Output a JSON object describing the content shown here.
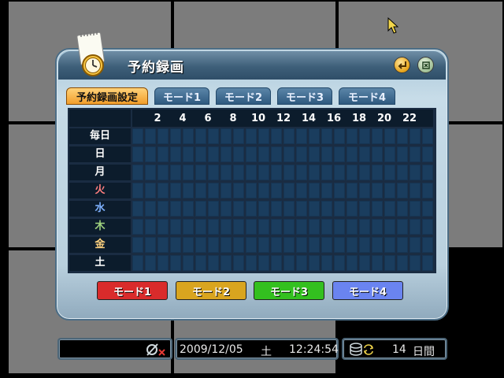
{
  "dialog": {
    "title": "予約録画",
    "enter_icon": "enter-icon",
    "close_icon": "close-icon"
  },
  "tabs": [
    {
      "label": "予約録画設定",
      "active": true
    },
    {
      "label": "モード1",
      "active": false
    },
    {
      "label": "モード2",
      "active": false
    },
    {
      "label": "モード3",
      "active": false
    },
    {
      "label": "モード4",
      "active": false
    }
  ],
  "schedule": {
    "hour_labels": [
      "2",
      "4",
      "6",
      "8",
      "10",
      "12",
      "14",
      "16",
      "18",
      "20",
      "22"
    ],
    "days": [
      {
        "label": "毎日",
        "color": "#ffffff"
      },
      {
        "label": "日",
        "color": "#ffffff"
      },
      {
        "label": "月",
        "color": "#ffffff"
      },
      {
        "label": "火",
        "color": "#ff7f7f"
      },
      {
        "label": "水",
        "color": "#7fb2ff"
      },
      {
        "label": "木",
        "color": "#9fd27f"
      },
      {
        "label": "金",
        "color": "#ffd27f"
      },
      {
        "label": "土",
        "color": "#ffffff"
      }
    ]
  },
  "mode_buttons": [
    {
      "label": "モード1",
      "color": "#d92b2b"
    },
    {
      "label": "モード2",
      "color": "#d9a51f"
    },
    {
      "label": "モード3",
      "color": "#33c01f"
    },
    {
      "label": "モード4",
      "color": "#6a84f0"
    }
  ],
  "status": {
    "network_icon": "network-disconnected-icon",
    "date": "2009/12/05",
    "weekday": "土",
    "time": "12:24:54",
    "storage_icon": "storage-overwrite-icon",
    "days_value": "14",
    "days_unit": "日間"
  },
  "colors": {
    "accent_tab": "#f19e2b",
    "cell": "#1a3d5e"
  }
}
